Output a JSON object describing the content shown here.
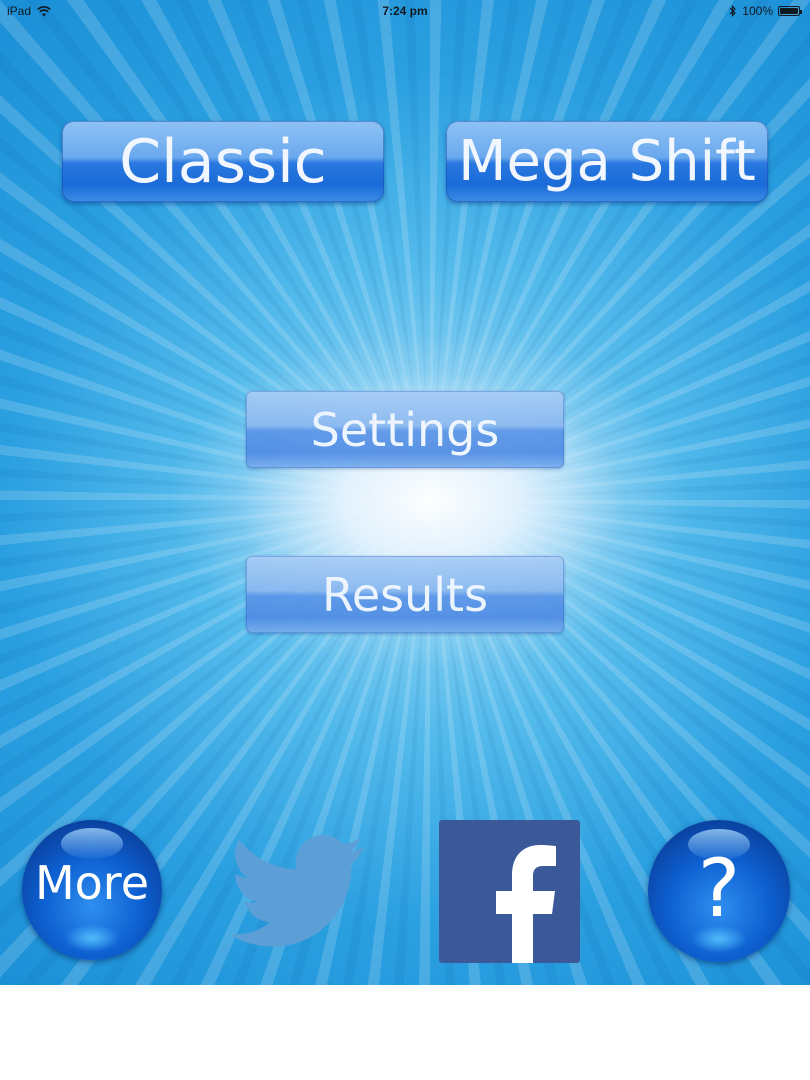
{
  "status_bar": {
    "device": "iPad",
    "time": "7:24 pm",
    "battery": "100%",
    "wifi_icon": "wifi-icon",
    "bluetooth_icon": "bluetooth-icon",
    "battery_level": 1.0
  },
  "menu": {
    "classic_label": "Classic",
    "mega_shift_label": "Mega Shift",
    "settings_label": "Settings",
    "results_label": "Results"
  },
  "bottom_bar": {
    "more_label": "More",
    "help_label": "?",
    "twitter_icon": "twitter-bird-icon",
    "facebook_icon": "facebook-icon"
  },
  "colors": {
    "background_blue": "#2a9fe0",
    "button_blue": "#1a6bd8",
    "orb_blue": "#0d5fd0",
    "facebook_blue": "#3b5998",
    "twitter_blue": "#5b9fd6"
  }
}
